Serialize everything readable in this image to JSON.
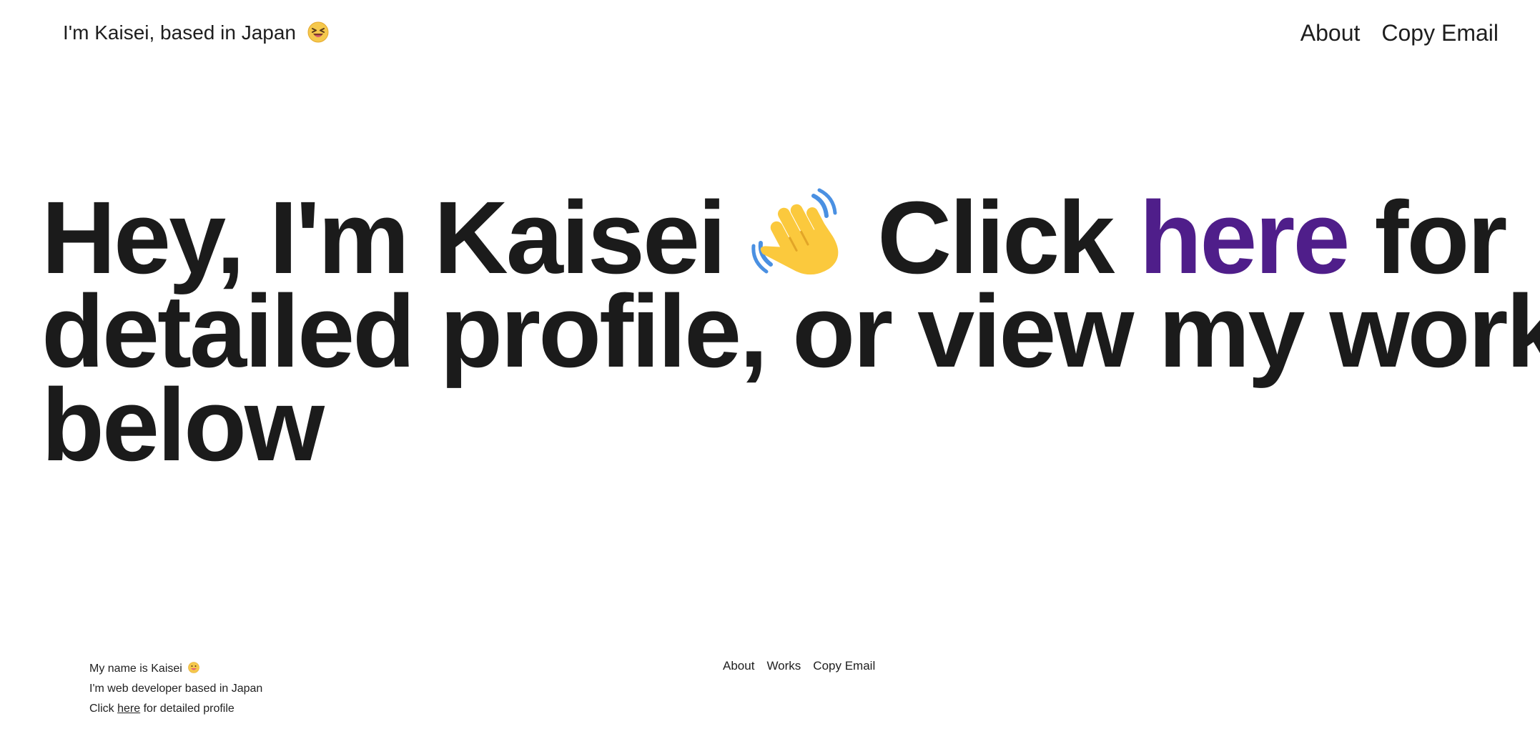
{
  "header": {
    "brand_text": "I'm Kaisei, based in Japan",
    "brand_emoji": "grinning-squinting-face-icon",
    "nav": {
      "about": "About",
      "copy_email": "Copy Email"
    }
  },
  "hero": {
    "line1_before": "Hey, I'm Kaisei",
    "wave_icon": "waving-hand-icon",
    "line1_click": "Click",
    "highlight": "here",
    "line1_after": "for",
    "line2": "detailed profile, or view my works",
    "line3": "below"
  },
  "footer": {
    "name_line": "My name is Kaisei",
    "role_line": "I'm web developer based in Japan",
    "click_prefix": "Click",
    "click_link": "here",
    "click_suffix": "for detailed profile",
    "nav": {
      "about": "About",
      "works": "Works",
      "copy_email": "Copy Email"
    }
  },
  "colors": {
    "text": "#1b1b1b",
    "accent": "#4f1e8a",
    "background": "#ffffff"
  }
}
